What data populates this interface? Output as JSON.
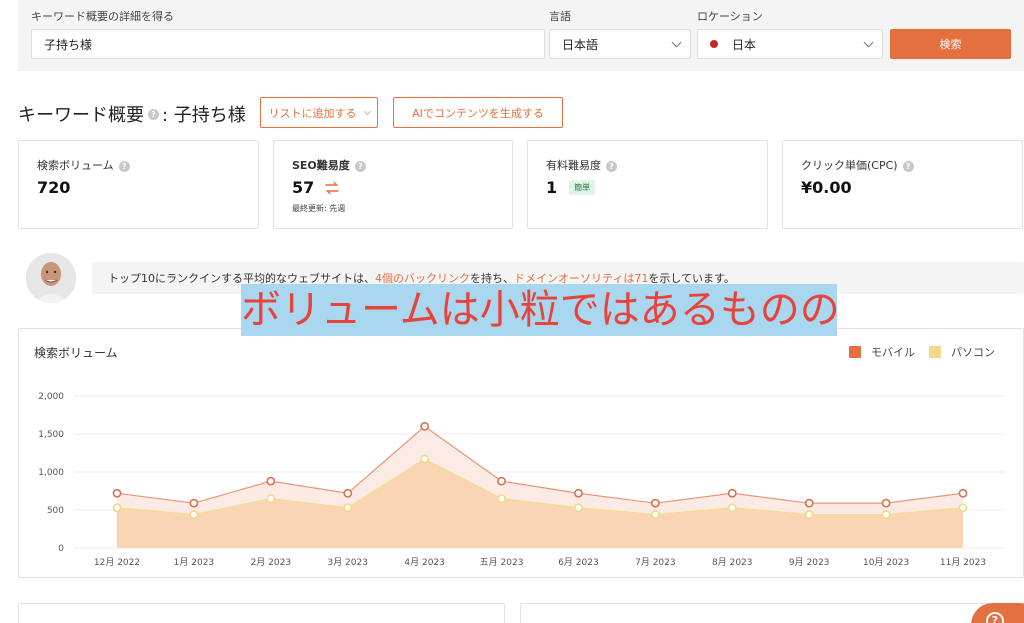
{
  "search": {
    "keyword_label": "キーワード概要の詳細を得る",
    "keyword_value": "子持ち様",
    "language_label": "言語",
    "language_value": "日本語",
    "location_label": "ロケーション",
    "location_value": "日本",
    "search_button": "検索"
  },
  "overview": {
    "title_prefix": "キーワード概要",
    "title_suffix": ": 子持ち様",
    "add_to_list_button": "リストに追加する",
    "ai_button": "AIでコンテンツを生成する"
  },
  "cards": [
    {
      "label": "検索ボリューム",
      "value": "720"
    },
    {
      "label": "SEO難易度",
      "value": "57",
      "sub": "最終更新: 先週"
    },
    {
      "label": "有料難易度",
      "value": "1",
      "badge": "簡単"
    },
    {
      "label": "クリック単価(CPC)",
      "value": "¥0.00"
    }
  ],
  "advice": {
    "part1": "トップ10にランクインする平均的なウェブサイトは、",
    "backlinks": "4個のバックリンク",
    "part2": "を持ち、",
    "authority": "ドメインオーソリティは71",
    "part3": "を示しています。"
  },
  "overlay_caption": "ボリュームは小粒ではあるものの",
  "chart_data": {
    "type": "area",
    "title": "検索ボリューム",
    "categories": [
      "12月 2022",
      "1月 2023",
      "2月 2023",
      "3月 2023",
      "4月 2023",
      "五月 2023",
      "6月 2023",
      "7月 2023",
      "8月 2023",
      "9月 2023",
      "10月 2023",
      "11月 2023"
    ],
    "series": [
      {
        "name": "モバイル",
        "color": "#e3703e",
        "values": [
          720,
          590,
          880,
          720,
          1600,
          880,
          720,
          590,
          720,
          590,
          590,
          720
        ]
      },
      {
        "name": "パソコン",
        "color": "#f6d48a",
        "values": [
          530,
          440,
          650,
          530,
          1170,
          650,
          530,
          440,
          530,
          440,
          440,
          530
        ]
      }
    ],
    "ylim": [
      0,
      2000
    ],
    "y_ticks": [
      "0",
      "500",
      "1,000",
      "1,500",
      "2,000"
    ],
    "grid": true,
    "legend_position": "top-right"
  },
  "colors": {
    "accent": "#e3703e",
    "panel_bg": "#f4f4f4",
    "overlay_bg": "#a9d7f0",
    "overlay_text": "#e8433a"
  }
}
